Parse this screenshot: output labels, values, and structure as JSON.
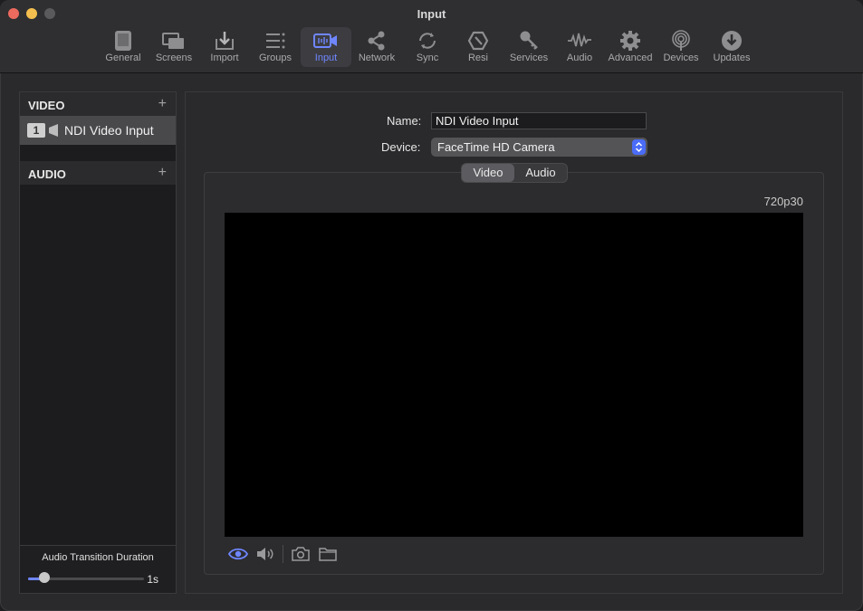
{
  "window": {
    "title": "Input"
  },
  "toolbar": {
    "items": [
      {
        "label": "General",
        "icon": "tablet-icon"
      },
      {
        "label": "Screens",
        "icon": "screens-icon"
      },
      {
        "label": "Import",
        "icon": "import-icon"
      },
      {
        "label": "Groups",
        "icon": "groups-icon"
      },
      {
        "label": "Input",
        "icon": "input-icon",
        "active": true
      },
      {
        "label": "Network",
        "icon": "network-icon"
      },
      {
        "label": "Sync",
        "icon": "sync-icon"
      },
      {
        "label": "Resi",
        "icon": "resi-icon"
      },
      {
        "label": "Services",
        "icon": "key-icon"
      },
      {
        "label": "Audio",
        "icon": "waveform-icon"
      },
      {
        "label": "Advanced",
        "icon": "gear-icon"
      },
      {
        "label": "Devices",
        "icon": "broadcast-icon"
      },
      {
        "label": "Updates",
        "icon": "download-circle-icon"
      }
    ]
  },
  "sidebar": {
    "video_header": "VIDEO",
    "audio_header": "AUDIO",
    "add_symbol": "+",
    "video_items": [
      {
        "number": "1",
        "label": "NDI Video Input"
      }
    ],
    "audio_transition": {
      "label": "Audio Transition Duration",
      "value": "1s",
      "slider_fraction": 0.14
    }
  },
  "main": {
    "name_label": "Name:",
    "name_value": "NDI Video Input",
    "device_label": "Device:",
    "device_value": "FaceTime HD Camera",
    "tabs": [
      "Video",
      "Audio"
    ],
    "active_tab": "Video",
    "resolution": "720p30"
  },
  "colors": {
    "accent": "#6f86ff",
    "select_stepper": "#4a6cf7"
  }
}
